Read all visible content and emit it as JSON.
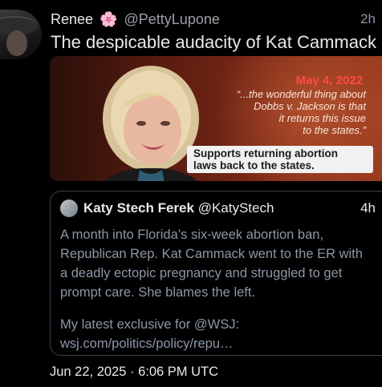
{
  "author": {
    "name": "Renee",
    "emoji": "🌸",
    "handle": "@PettyLupone",
    "time": "2h"
  },
  "tweet": {
    "text": "The despicable audacity of Kat Cammack"
  },
  "media": {
    "date": "May 4, 2022",
    "quote_lines": [
      "“...the wonderful thing about",
      "Dobbs v. Jackson is that",
      "it returns this issue",
      "to the states.”"
    ],
    "caption_lines": [
      "Supports returning abortion",
      "laws back to the states."
    ]
  },
  "quoted": {
    "name": "Katy Stech Ferek",
    "handle": "@KatyStech",
    "time": "4h",
    "body_lines": [
      "A month into Florida’s six-week abortion ban,",
      "Republican Rep. Kat Cammack went to the ER with",
      "a deadly ectopic pregnancy and struggled to get",
      "prompt care. She blames the left."
    ],
    "tail_lines": [
      "My latest exclusive for @WSJ:",
      "wsj.com/politics/policy/repu…"
    ]
  },
  "footer": {
    "timestamp": "Jun 22, 2025 · 6:06 PM UTC"
  }
}
